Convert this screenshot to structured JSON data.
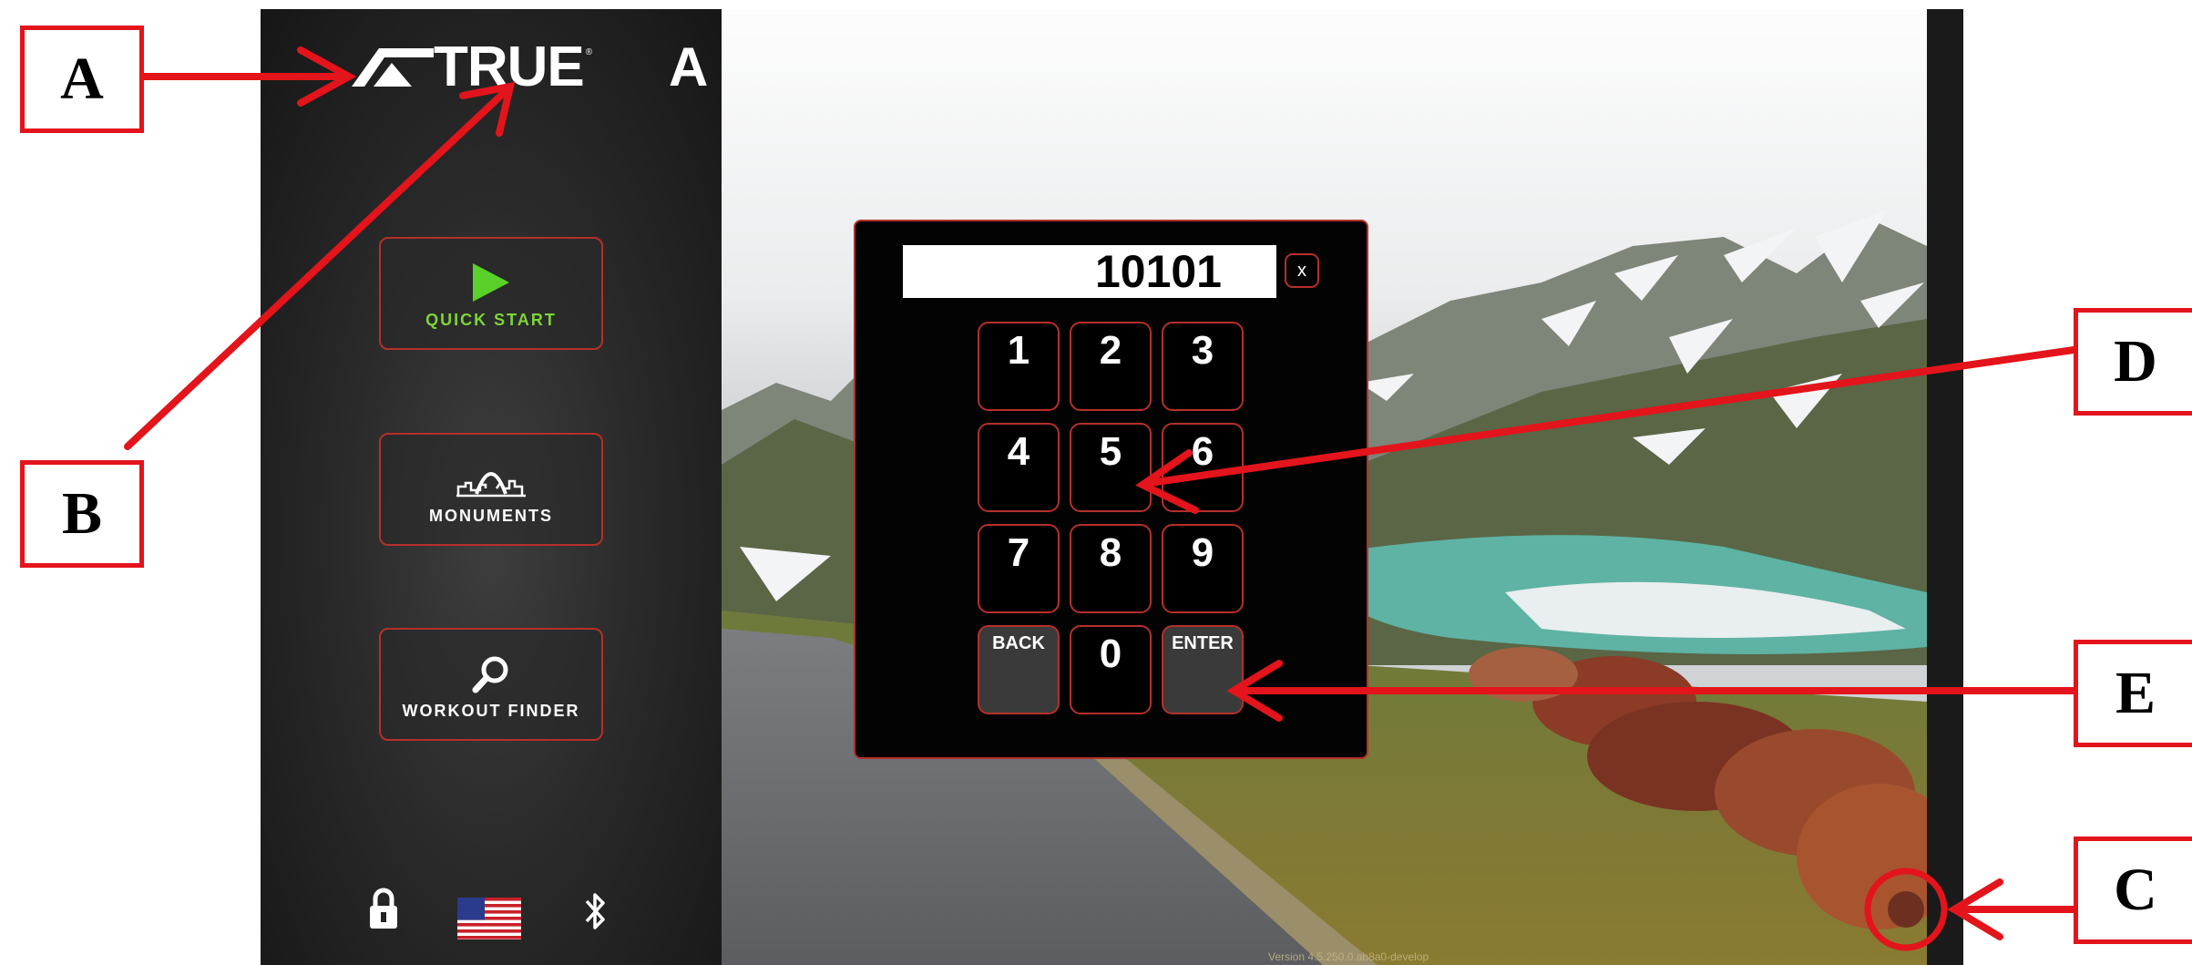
{
  "brand": {
    "logo_text": "TRUE",
    "trademark": "®",
    "partial_title": "A"
  },
  "sidebar": {
    "quick_start_label": "QUICK START",
    "monuments_label": "MONUMENTS",
    "workout_finder_label": "WORKOUT FINDER",
    "bottom_icons": [
      "lock-icon",
      "us-flag-icon",
      "bluetooth-icon"
    ]
  },
  "keypad": {
    "display_value": "10101",
    "close_label": "x",
    "keys": [
      "1",
      "2",
      "3",
      "4",
      "5",
      "6",
      "7",
      "8",
      "9",
      "BACK",
      "0",
      "ENTER"
    ]
  },
  "version_text": "Version 4.5.250.0.ab8a0-develop",
  "callouts": {
    "a": "A",
    "b": "B",
    "c": "C",
    "d": "D",
    "e": "E"
  },
  "colors": {
    "accent_red": "#b5302a",
    "quick_start_green": "#7cd636",
    "callout_red": "#e3141b"
  }
}
